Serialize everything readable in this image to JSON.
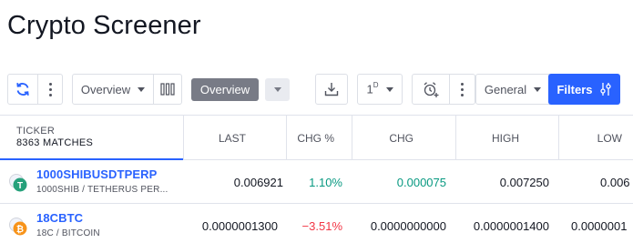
{
  "page": {
    "title": "Crypto Screener"
  },
  "toolbar": {
    "column_set_label": "Overview",
    "overview_tab_label": "Overview",
    "interval_label": "1",
    "interval_sup": "D",
    "category_label": "General",
    "filters_label": "Filters"
  },
  "table": {
    "ticker_header": "TICKER",
    "matches": "8363 MATCHES",
    "columns": [
      "LAST",
      "CHG %",
      "CHG",
      "HIGH",
      "LOW"
    ],
    "rows": [
      {
        "symbol": "1000SHIBUSDTPERP",
        "description": "1000SHIB / TETHERUS PER...",
        "last": "0.006921",
        "chg_pct": "1.10%",
        "chg": "0.000075",
        "high": "0.007250",
        "low": "0.006",
        "direction": "up"
      },
      {
        "symbol": "18CBTC",
        "description": "18C / BITCOIN",
        "last": "0.0000001300",
        "chg_pct": "−3.51%",
        "chg": "0.0000000000",
        "high": "0.0000001400",
        "low": "0.0000001",
        "direction": "down"
      }
    ]
  },
  "colors": {
    "accent": "#2962ff",
    "positive": "#089981",
    "negative": "#f23645",
    "pill": "#787b86"
  }
}
